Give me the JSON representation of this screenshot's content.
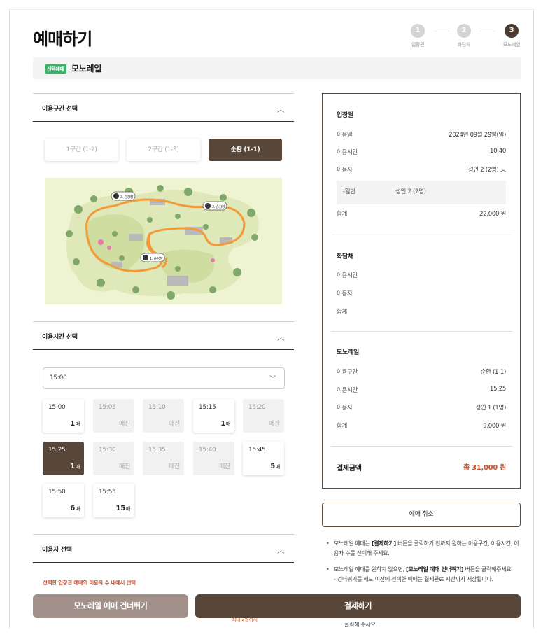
{
  "page_title": "예매하기",
  "steps": [
    {
      "num": "1",
      "label": "입장권"
    },
    {
      "num": "2",
      "label": "화담채"
    },
    {
      "num": "3",
      "label": "모노레일"
    }
  ],
  "banner": {
    "tag": "선택예매",
    "name": "모노레일"
  },
  "route_section": {
    "title": "이용구간 선택",
    "options": [
      "1구간 (1-2)",
      "2구간 (1-3)",
      "순환 (1-1)"
    ],
    "selected": "순환 (1-1)",
    "map": {
      "stations": [
        "1. 승강장",
        "2. 승강장",
        "3. 승강장"
      ]
    }
  },
  "time_section": {
    "title": "이용시간 선택",
    "dropdown_value": "15:00",
    "unit": "매",
    "slots": [
      {
        "time": "15:00",
        "count": "1",
        "status": "available"
      },
      {
        "time": "15:05",
        "count": "매진",
        "status": "soldout"
      },
      {
        "time": "15:10",
        "count": "매진",
        "status": "soldout"
      },
      {
        "time": "15:15",
        "count": "1",
        "status": "available"
      },
      {
        "time": "15:20",
        "count": "매진",
        "status": "soldout"
      },
      {
        "time": "15:25",
        "count": "1",
        "status": "selected"
      },
      {
        "time": "15:30",
        "count": "매진",
        "status": "soldout"
      },
      {
        "time": "15:35",
        "count": "매진",
        "status": "soldout"
      },
      {
        "time": "15:40",
        "count": "매진",
        "status": "soldout"
      },
      {
        "time": "15:45",
        "count": "5",
        "status": "available"
      },
      {
        "time": "15:50",
        "count": "6",
        "status": "available"
      },
      {
        "time": "15:55",
        "count": "15",
        "status": "available"
      }
    ]
  },
  "people_section": {
    "title": "이용자 선택",
    "notice": "선택한 입장권 예매의 이용자 수 내에서 선택",
    "max_text": "최대 2명까지"
  },
  "summary": {
    "ticket": {
      "title": "입장권",
      "date_label": "이용일",
      "date_value": "2024년 09월 29일(일)",
      "time_label": "이용시간",
      "time_value": "10:40",
      "user_label": "이용자",
      "user_value": "성인 2 (2명)",
      "sub_type": "-일반",
      "sub_value": "성인 2 (2명)",
      "sum_label": "합계",
      "sum_value": "22,000 원"
    },
    "hwadam": {
      "title": "화담채",
      "time_label": "이용시간",
      "user_label": "이용자",
      "sum_label": "합계"
    },
    "monorail": {
      "title": "모노레일",
      "route_label": "이용구간",
      "route_value": "순환 (1-1)",
      "time_label": "이용시간",
      "time_value": "15:25",
      "user_label": "이용자",
      "user_value": "성인 1 (1명)",
      "sum_label": "합계",
      "sum_value": "9,000 원"
    },
    "total_label": "결제금액",
    "total_value": "총 31,000 원"
  },
  "cancel_button": "예매 취소",
  "notes": {
    "n1_a": "모노레일 예매는 ",
    "n1_b": "[결제하기]",
    "n1_c": " 버튼을 클릭하기 전까지 원하는 이용구간, 이용시간, 이용자 수를 선택해 주세요.",
    "n2_a": "모노레일 예매를 원하지 않으면, ",
    "n2_b": "[모노레일 예매 건너뛰기]",
    "n2_c": " 버튼을 클릭해주세요.",
    "n2_d": "- 건너뛰기를 해도 이전에 선택한 예매는 결제완료 시간까지 저장됩니다.",
    "n3": "클릭해 주세요."
  },
  "buttons": {
    "skip": "모노레일 예매 건너뛰기",
    "pay": "결제하기"
  },
  "colors": {
    "brand_brown": "#584639",
    "accent_red": "#c8502c",
    "tag_green": "#3eb06a"
  }
}
